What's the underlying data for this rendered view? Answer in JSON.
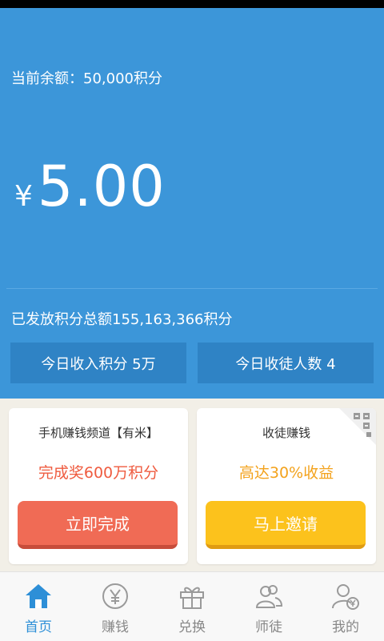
{
  "header": {
    "balance_line": "当前余额：50,000积分",
    "currency_symbol": "¥",
    "amount": "5.00",
    "total_line": "已发放积分总额155,163,366积分",
    "stats": {
      "today_income": "今日收入积分 5万",
      "today_disciples": "今日收徒人数 4"
    }
  },
  "cards": {
    "left": {
      "title": "手机赚钱频道【有米】",
      "reward": "完成奖600万积分",
      "button": "立即完成"
    },
    "right": {
      "title": "收徒赚钱",
      "reward": "高达30%收益",
      "button": "马上邀请"
    }
  },
  "tabs": [
    {
      "label": "首页",
      "icon": "home-icon",
      "active": true
    },
    {
      "label": "赚钱",
      "icon": "yen-coin-icon",
      "active": false
    },
    {
      "label": "兑换",
      "icon": "gift-icon",
      "active": false
    },
    {
      "label": "师徒",
      "icon": "users-icon",
      "active": false
    },
    {
      "label": "我的",
      "icon": "user-yen-icon",
      "active": false
    }
  ],
  "colors": {
    "header_bg": "#3c96d9",
    "stat_box_bg": "#2f83c5",
    "red_button": "#f06b55",
    "yellow_button": "#fcc21c",
    "active_tab": "#2d8fd7",
    "inactive_tab": "#888888"
  }
}
